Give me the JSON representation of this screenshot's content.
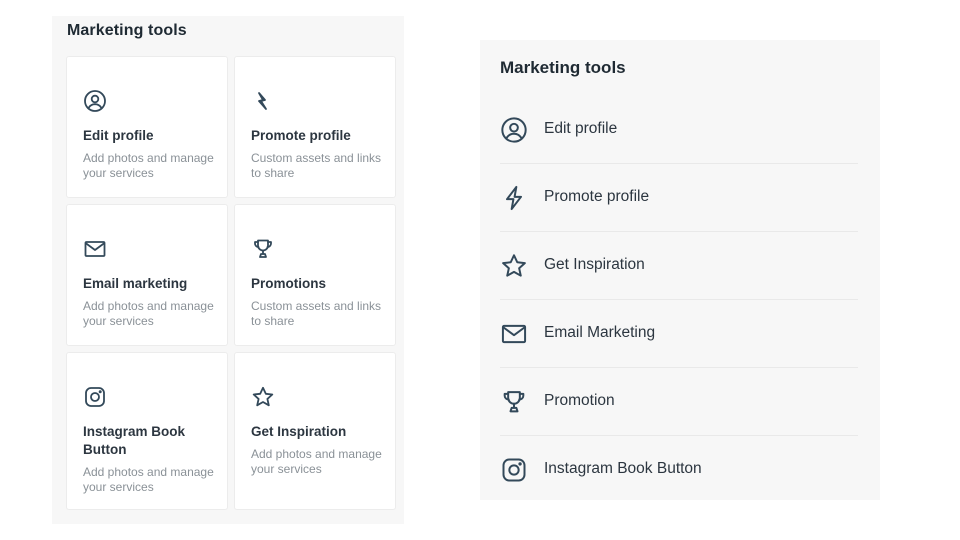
{
  "colors": {
    "icon": "#33495a",
    "text": "#2c3640",
    "muted": "#8a9197",
    "panel_bg": "#f7f7f7"
  },
  "left_panel": {
    "title": "Marketing tools",
    "cards": [
      {
        "icon": "user-circle-icon",
        "title": "Edit profile",
        "desc": "Add photos and manage your services"
      },
      {
        "icon": "lightning-icon",
        "title": "Promote profile",
        "desc": "Custom assets and links to share"
      },
      {
        "icon": "envelope-icon",
        "title": "Email marketing",
        "desc": "Add photos and manage your services"
      },
      {
        "icon": "trophy-icon",
        "title": "Promotions",
        "desc": "Custom assets and links to share"
      },
      {
        "icon": "instagram-icon",
        "title": "Instagram Book Button",
        "desc": "Add photos and manage your services"
      },
      {
        "icon": "star-icon",
        "title": "Get Inspiration",
        "desc": "Add photos and manage your services"
      }
    ]
  },
  "right_panel": {
    "title": "Marketing tools",
    "items": [
      {
        "icon": "user-circle-icon",
        "label": "Edit profile"
      },
      {
        "icon": "lightning-icon",
        "label": "Promote profile"
      },
      {
        "icon": "star-icon",
        "label": "Get Inspiration"
      },
      {
        "icon": "envelope-icon",
        "label": "Email Marketing"
      },
      {
        "icon": "trophy-icon",
        "label": "Promotion"
      },
      {
        "icon": "instagram-icon",
        "label": "Instagram Book Button"
      }
    ]
  }
}
